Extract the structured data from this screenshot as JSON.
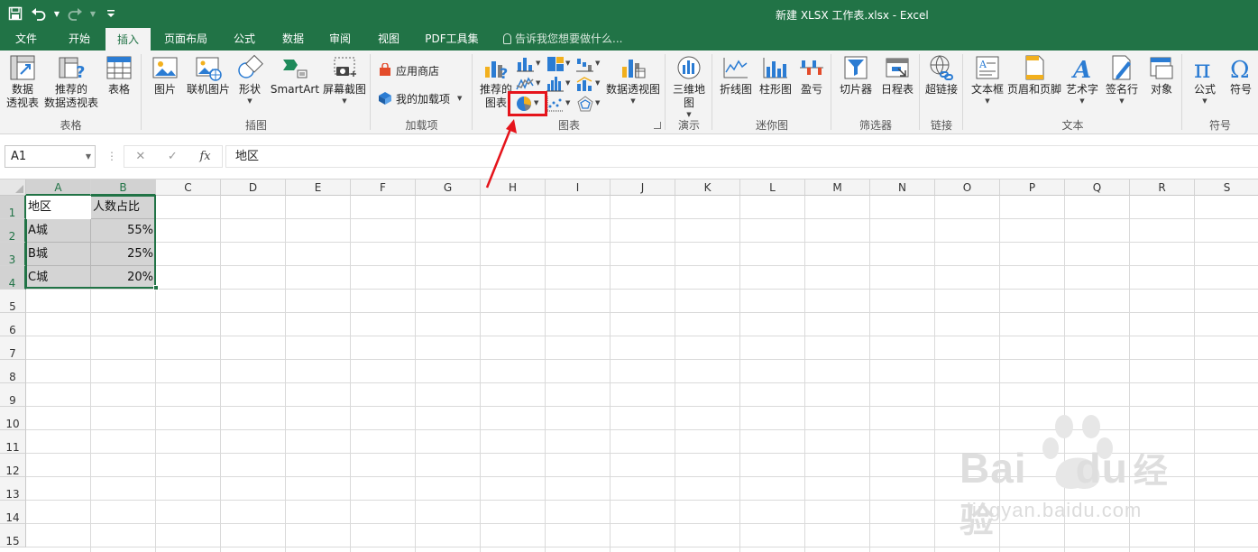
{
  "window": {
    "title": "新建 XLSX 工作表.xlsx - Excel"
  },
  "colors": {
    "brand": "#217346",
    "highlight": "#e5141b"
  },
  "quick_access": {
    "save_icon": "save-icon",
    "undo_icon": "undo-icon",
    "redo_icon": "redo-icon",
    "customize_icon": "customize-qat-icon"
  },
  "tabs": [
    {
      "label": "文件"
    },
    {
      "label": "开始"
    },
    {
      "label": "插入",
      "active": true
    },
    {
      "label": "页面布局"
    },
    {
      "label": "公式"
    },
    {
      "label": "数据"
    },
    {
      "label": "审阅"
    },
    {
      "label": "视图"
    },
    {
      "label": "PDF工具集"
    }
  ],
  "tell_me": "告诉我您想要做什么...",
  "ribbon": {
    "groups": {
      "tables": {
        "label": "表格",
        "pivot_line1": "数据",
        "pivot_line2": "透视表",
        "rec_pivot_line1": "推荐的",
        "rec_pivot_line2": "数据透视表",
        "table": "表格"
      },
      "illustrations": {
        "label": "插图",
        "pictures": "图片",
        "online_pictures": "联机图片",
        "shapes": "形状",
        "smartart": "SmartArt",
        "screenshot": "屏幕截图"
      },
      "addins": {
        "label": "加载项",
        "store": "应用商店",
        "my_addins": "我的加载项"
      },
      "charts": {
        "label": "图表",
        "recommended_line1": "推荐的",
        "recommended_line2": "图表",
        "pivotchart": "数据透视图"
      },
      "tours": {
        "label": "演示",
        "map3d_line1": "三维地",
        "map3d_line2": "图"
      },
      "sparklines": {
        "label": "迷你图",
        "line": "折线图",
        "column": "柱形图",
        "winloss": "盈亏"
      },
      "filters": {
        "label": "筛选器",
        "slicer": "切片器",
        "timeline": "日程表"
      },
      "links": {
        "label": "链接",
        "hyperlink": "超链接"
      },
      "text": {
        "label": "文本",
        "textbox": "文本框",
        "header_footer": "页眉和页脚",
        "wordart": "艺术字",
        "signature": "签名行",
        "object": "对象"
      },
      "symbols": {
        "label": "符号",
        "equation": "公式",
        "symbol": "符号"
      }
    }
  },
  "formula_bar": {
    "name_box": "A1",
    "cancel": "✕",
    "enter": "✓",
    "fx": "fx",
    "content": "地区"
  },
  "columns": [
    "A",
    "B",
    "C",
    "D",
    "E",
    "F",
    "G",
    "H",
    "I",
    "J",
    "K",
    "L",
    "M",
    "N",
    "O",
    "P",
    "Q",
    "R",
    "S"
  ],
  "rows": [
    "1",
    "2",
    "3",
    "4",
    "5",
    "6",
    "7",
    "8",
    "9",
    "10",
    "11",
    "12",
    "13",
    "14",
    "15"
  ],
  "cells": {
    "A1": "地区",
    "B1": "人数占比",
    "A2": "A城",
    "B2": "55%",
    "A3": "B城",
    "B3": "25%",
    "A4": "C城",
    "B4": "20%"
  },
  "watermark": {
    "brand": "Bai",
    "brand_tail": "du",
    "cn": "经验",
    "url": "jingyan.baidu.com"
  }
}
